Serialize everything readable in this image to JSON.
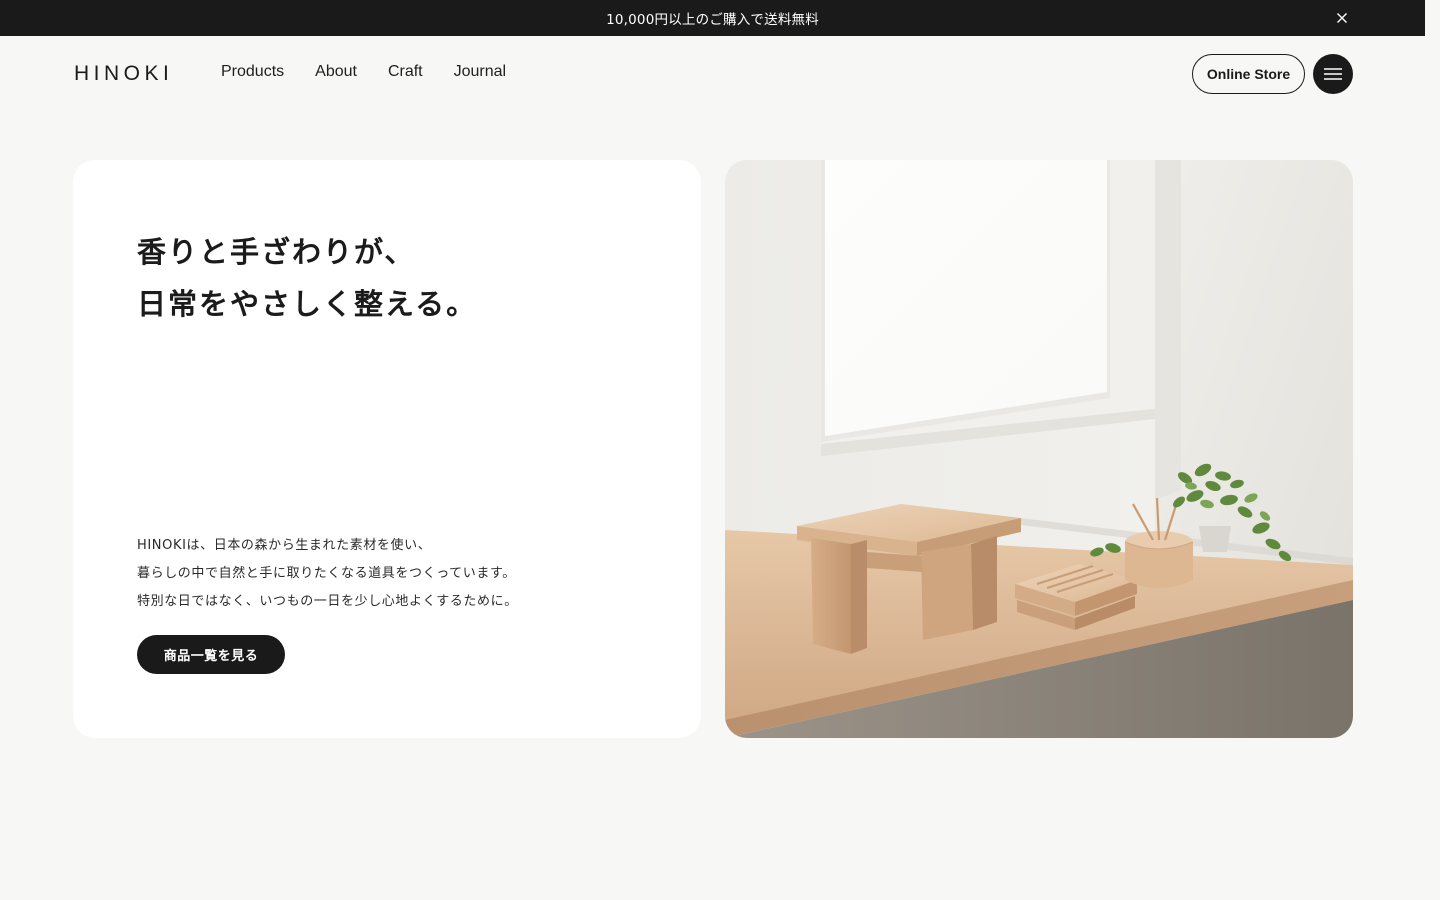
{
  "announcement": {
    "text": "10,000円以上のご購入で送料無料",
    "close_icon": "close-icon"
  },
  "header": {
    "logo": "HINOKI",
    "nav": [
      {
        "label": "Products"
      },
      {
        "label": "About"
      },
      {
        "label": "Craft"
      },
      {
        "label": "Journal"
      }
    ],
    "store_label": "Online Store",
    "menu_icon": "hamburger-menu-icon"
  },
  "hero": {
    "title_lines": [
      "香りと手ざわりが、",
      "日常をやさしく整える。"
    ],
    "body_lines": [
      "HINOKIは、日本の森から生まれた素材を使い、",
      "暮らしの中で自然と手に取りたくなる道具をつくっています。",
      "特別な日ではなく、いつもの一日を少し心地よくするために。"
    ],
    "cta_label": "商品一覧を見る"
  },
  "colors": {
    "background": "#f7f7f5",
    "dark": "#1a1a1a",
    "card": "#ffffff",
    "wood": "#d9b48f"
  }
}
